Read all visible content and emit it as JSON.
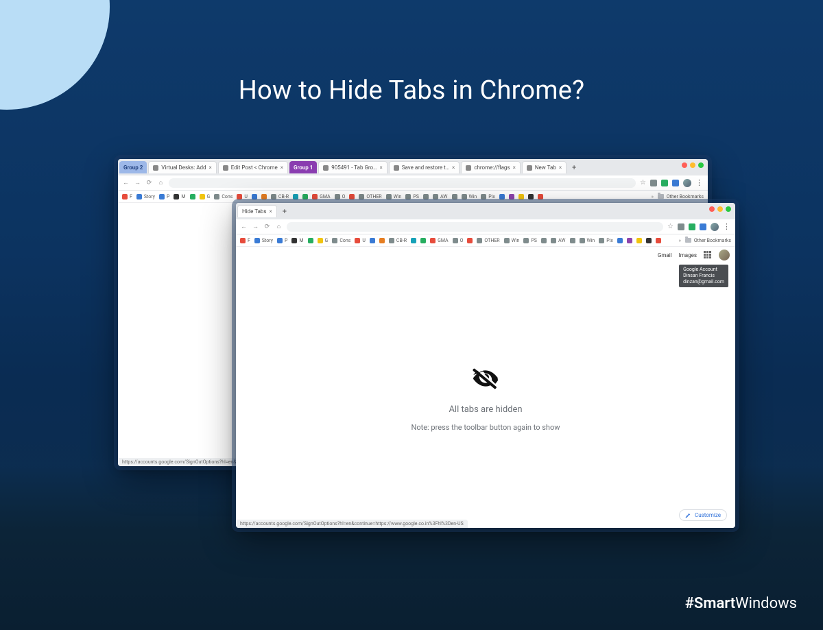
{
  "page": {
    "title": "How to Hide Tabs in Chrome?",
    "hashtag_strong": "#Smart",
    "hashtag_light": "Windows"
  },
  "window1": {
    "tab_groups": [
      {
        "label": "Group 2",
        "class": "tg-blue"
      }
    ],
    "tabs": [
      {
        "label": "Virtual Desks: Add",
        "fav": "c-grn"
      },
      {
        "label": "Edit Post < Chrome",
        "fav": "c-red"
      }
    ],
    "tab_group_mid": {
      "label": "Group 1",
      "class": "tg-purple"
    },
    "tabs2": [
      {
        "label": "905491 - Tab Gro…",
        "fav": "c-pink"
      },
      {
        "label": "Save and restore t…",
        "fav": "c-gry"
      },
      {
        "label": "chrome://flags",
        "fav": "c-blu"
      },
      {
        "label": "New Tab",
        "fav": "c-gry"
      }
    ],
    "newtab": "+",
    "bookmarks": [
      {
        "label": "F",
        "c": "c-red"
      },
      {
        "label": "Story",
        "c": "c-blu"
      },
      {
        "label": "P",
        "c": "c-blu"
      },
      {
        "label": "M",
        "c": "c-blk"
      },
      {
        "label": "",
        "c": "c-grn"
      },
      {
        "label": "G",
        "c": "c-ylw"
      },
      {
        "label": "Cons",
        "c": "c-gry"
      },
      {
        "label": "U",
        "c": "c-red"
      },
      {
        "label": "",
        "c": "c-blu"
      },
      {
        "label": "",
        "c": "c-org"
      },
      {
        "label": "CB-R",
        "c": "c-gry"
      },
      {
        "label": "",
        "c": "c-cyan"
      },
      {
        "label": "",
        "c": "c-grn"
      },
      {
        "label": "GMA",
        "c": "c-red"
      },
      {
        "label": "O",
        "c": "c-gry"
      },
      {
        "label": "",
        "c": "c-red"
      },
      {
        "label": "OTHER",
        "c": "c-gry"
      },
      {
        "label": "Win",
        "c": "c-gry"
      },
      {
        "label": "PS",
        "c": "c-gry"
      },
      {
        "label": "",
        "c": "c-gry"
      },
      {
        "label": "AW",
        "c": "c-gry"
      },
      {
        "label": "",
        "c": "c-gry"
      },
      {
        "label": "Win",
        "c": "c-gry"
      },
      {
        "label": "Pix",
        "c": "c-gry"
      },
      {
        "label": "",
        "c": "c-blu"
      },
      {
        "label": "",
        "c": "c-pur"
      },
      {
        "label": "",
        "c": "c-ylw"
      },
      {
        "label": "",
        "c": "c-blk"
      },
      {
        "label": "",
        "c": "c-red"
      }
    ],
    "other_bookmarks": "Other Bookmarks",
    "ntp": {
      "gmail": "Gmail",
      "images": "Images"
    },
    "tooltip": "Google Account",
    "statusbar": "https://accounts.google.com/SignOutOptions?hl=en&continue=https://www…"
  },
  "window2": {
    "tab": {
      "label": "Hide Tabs"
    },
    "newtab": "+",
    "bookmarks_same_as_win1": true,
    "other_bookmarks": "Other Bookmarks",
    "ntp": {
      "gmail": "Gmail",
      "images": "Images"
    },
    "tooltip_lines": [
      "Google Account",
      "Dinsan Francis",
      "dinzan@gmail.com"
    ],
    "hidden": {
      "title": "All tabs are hidden",
      "note": "Note: press the toolbar button again to show"
    },
    "customize": "Customize",
    "statusbar": "https://accounts.google.com/SignOutOptions?hl=en&continue=https://www.google.co.in%3Fhl%3Den-US"
  }
}
